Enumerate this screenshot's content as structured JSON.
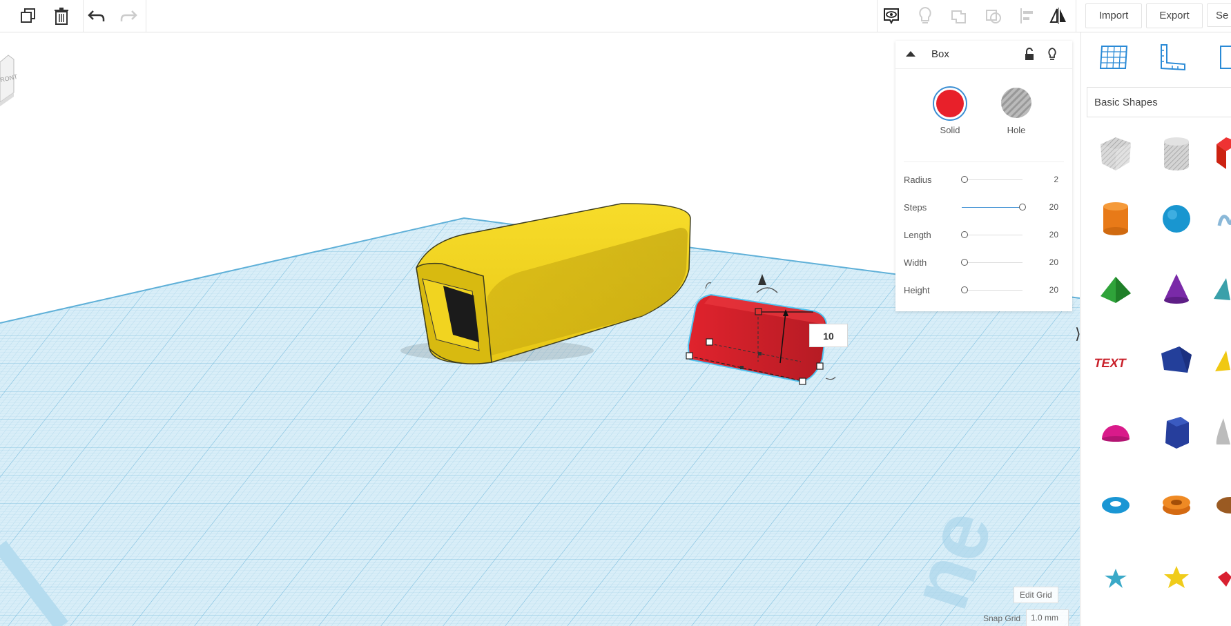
{
  "toolbar": {
    "import_label": "Import",
    "export_label": "Export",
    "send_label": "Se"
  },
  "viewcube": {
    "face_label": "RONT"
  },
  "inspector": {
    "title": "Box",
    "solid_label": "Solid",
    "hole_label": "Hole",
    "solid_color": "#e8202a",
    "props": [
      {
        "label": "Radius",
        "value": "2",
        "fill": 0.05
      },
      {
        "label": "Steps",
        "value": "20",
        "fill": 1.0
      },
      {
        "label": "Length",
        "value": "20",
        "fill": 0.05
      },
      {
        "label": "Width",
        "value": "20",
        "fill": 0.05
      },
      {
        "label": "Height",
        "value": "20",
        "fill": 0.05
      }
    ]
  },
  "viewport": {
    "dimension_value": "10"
  },
  "grid": {
    "edit_label": "Edit Grid",
    "snap_label": "Snap Grid",
    "snap_value": "1.0 mm"
  },
  "library": {
    "category": "Basic Shapes"
  },
  "colors": {
    "accent": "#4fa8d8",
    "yellow": "#f2d31b",
    "red": "#d5222c"
  }
}
